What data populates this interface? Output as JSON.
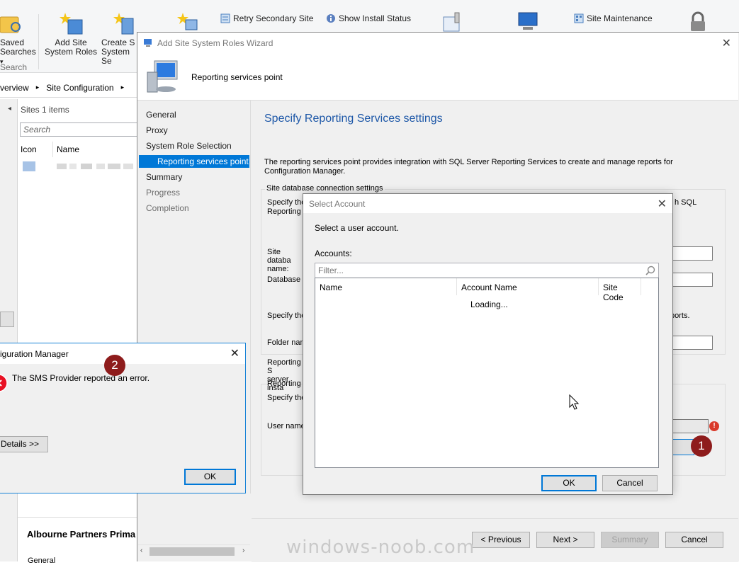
{
  "ribbon": {
    "saved_searches_label": "Saved\nSearches",
    "saved_searches_caret": "▾",
    "search_group_label": "Search",
    "add_site_system_roles": "Add Site\nSystem Roles",
    "create_site_system": "Create S\nSystem Se",
    "retry_secondary_site": "Retry Secondary Site",
    "show_install_status": "Show Install Status",
    "site_maintenance": "Site Maintenance"
  },
  "breadcrumb": {
    "items": [
      "verview",
      "Site Configuration"
    ],
    "separator": "▸"
  },
  "sites_panel": {
    "header": "Sites 1 items",
    "search_placeholder": "Search",
    "columns": [
      "Icon",
      "Name"
    ],
    "collapse_arrow": "◂"
  },
  "details_pane": {
    "site_name": "Albourne Partners Prima",
    "tab_general": "General"
  },
  "wizard": {
    "title": "Add Site System Roles Wizard",
    "header_title": "Reporting services point",
    "nav": {
      "general": "General",
      "proxy": "Proxy",
      "system_role_selection": "System Role Selection",
      "reporting_services_point": "Reporting services point",
      "summary": "Summary",
      "progress": "Progress",
      "completion": "Completion"
    },
    "page_title": "Specify Reporting Services settings",
    "description": "The reporting services point provides integration with SQL Server Reporting Services to create and manage reports for Configuration Manager.",
    "site_db_group": "Site database connection settings",
    "label_specify_the_1": "Specify the",
    "label_reporting_s_1": "Reporting S",
    "label_tail_1": "h SQL",
    "label_site_db_name": "Site databa\nname:",
    "label_database_name": "Database n",
    "label_specify_the_2": "Specify the",
    "label_tail_2": "ports.",
    "label_folder_name": "Folder nam",
    "label_reporting_server_instance": "Reporting S\nserver insta",
    "label_reporting_s_2": "Reporting S",
    "label_specify_the_3": "Specify the",
    "label_user_name": "User name",
    "set_button_tail": ".",
    "buttons": {
      "previous": "< Previous",
      "next": "Next >",
      "summary": "Summary",
      "cancel": "Cancel"
    }
  },
  "select_account": {
    "title": "Select Account",
    "instruction": "Select a user account.",
    "accounts_label": "Accounts:",
    "filter_placeholder": "Filter...",
    "columns": [
      "Name",
      "Account Name",
      "Site Code"
    ],
    "loading_text": "Loading...",
    "ok": "OK",
    "cancel": "Cancel"
  },
  "error_dialog": {
    "title": "iguration Manager",
    "message": "The SMS Provider reported an error.",
    "details_button": "Details >>",
    "ok": "OK"
  },
  "badges": {
    "one": "1",
    "two": "2"
  },
  "watermark": "windows-noob.com",
  "colors": {
    "accent": "#0078d7",
    "title_blue": "#1e58a8",
    "badge_red": "#8e1c1c",
    "error_red": "#d93a2a"
  }
}
